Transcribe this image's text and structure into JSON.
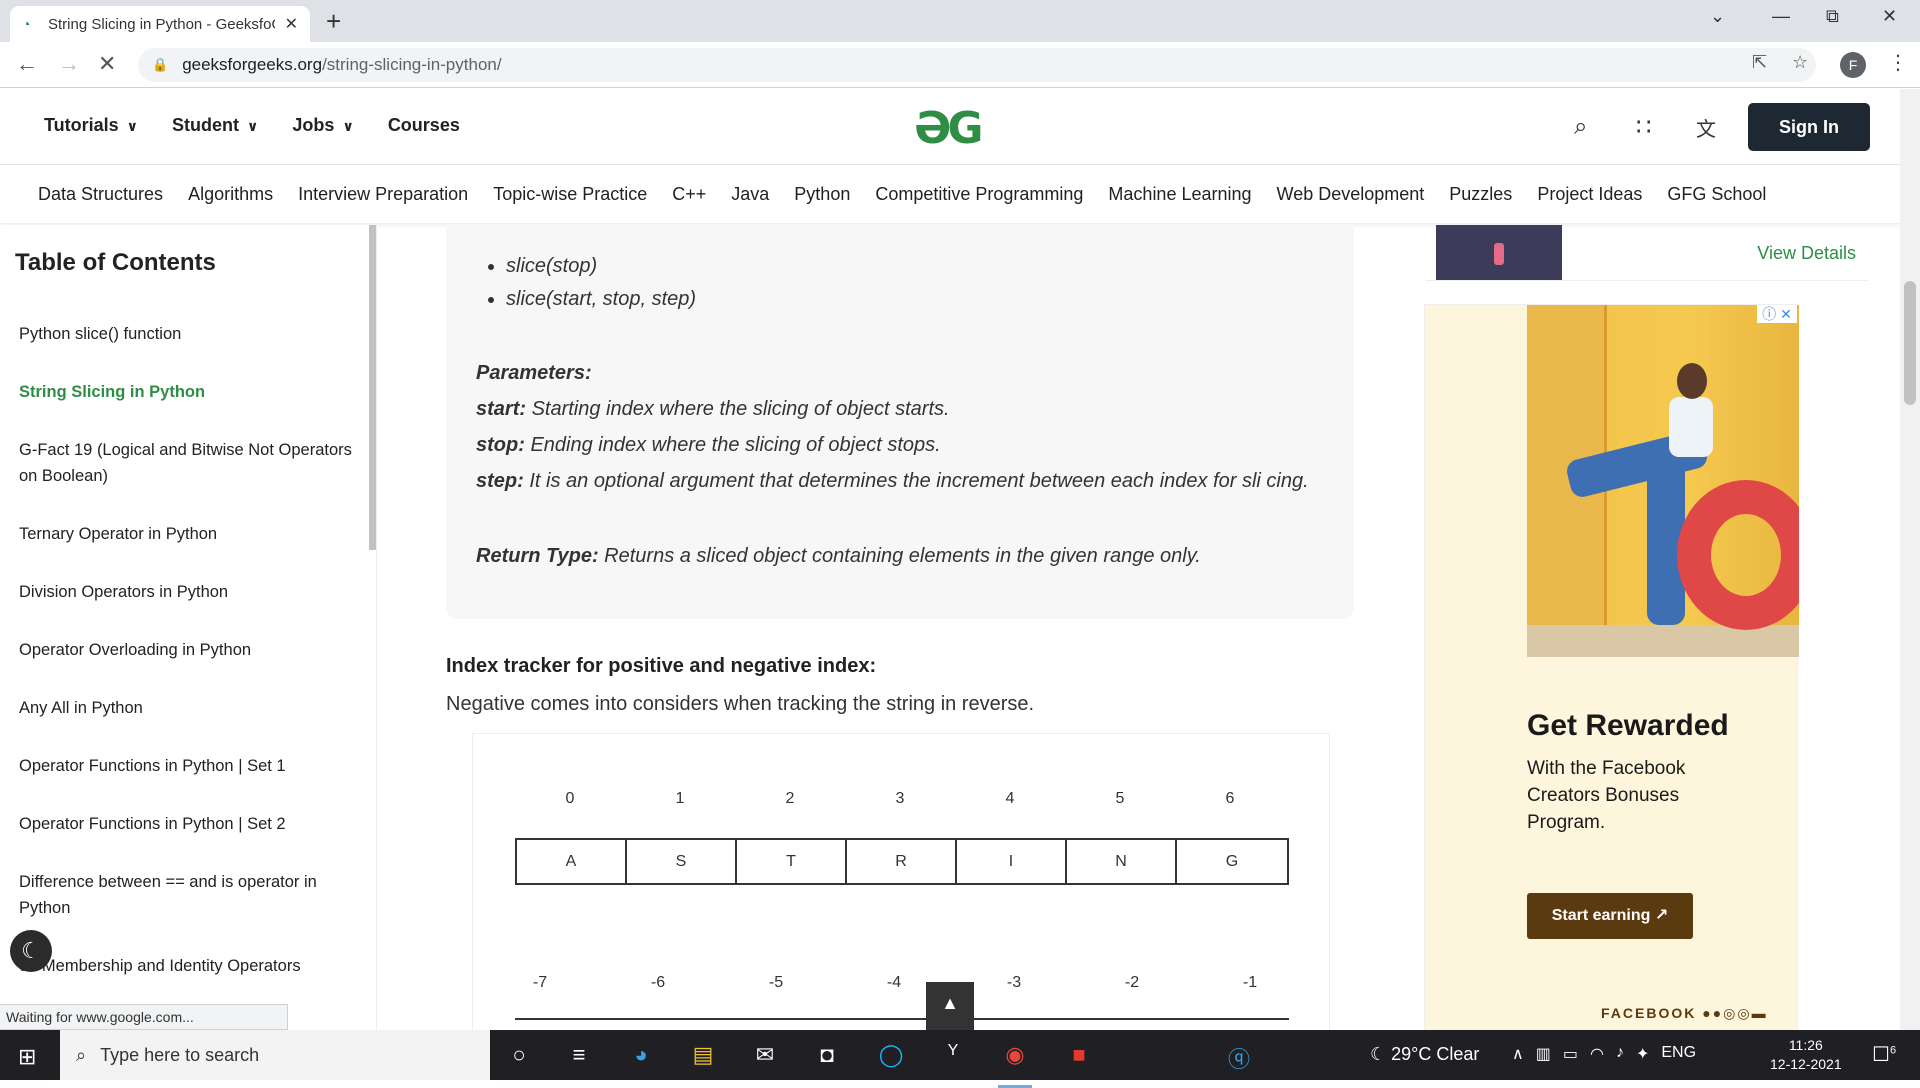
{
  "browser": {
    "tab_title": "String Slicing in Python - GeeksfoGeeks",
    "tab_favicon": "gfg-favicon-icon",
    "url_host": "geeksforgeeks.org",
    "url_path": "/string-slicing-in-python/",
    "profile_initial": "F",
    "status_text": "Waiting for www.google.com..."
  },
  "site": {
    "logo_text": "ƏG",
    "top_nav": [
      {
        "label": "Tutorials",
        "dropdown": true
      },
      {
        "label": "Student",
        "dropdown": true
      },
      {
        "label": "Jobs",
        "dropdown": true
      },
      {
        "label": "Courses",
        "dropdown": false
      }
    ],
    "signin_label": "Sign In",
    "sub_nav": [
      "Data Structures",
      "Algorithms",
      "Interview Preparation",
      "Topic-wise Practice",
      "C++",
      "Java",
      "Python",
      "Competitive Programming",
      "Machine Learning",
      "Web Development",
      "Puzzles",
      "Project Ideas",
      "GFG School"
    ]
  },
  "toc": {
    "title": "Table of Contents",
    "items": [
      {
        "label": "Python slice() function",
        "active": false
      },
      {
        "label": "String Slicing in Python",
        "active": true
      },
      {
        "label": "G-Fact 19 (Logical and Bitwise Not Operators on Boolean)",
        "active": false
      },
      {
        "label": "Ternary Operator in Python",
        "active": false
      },
      {
        "label": "Division Operators in Python",
        "active": false
      },
      {
        "label": "Operator Overloading in Python",
        "active": false
      },
      {
        "label": "Any All in Python",
        "active": false
      },
      {
        "label": "Operator Functions in Python | Set 1",
        "active": false
      },
      {
        "label": "Operator Functions in Python | Set 2",
        "active": false
      },
      {
        "label": "Difference between == and is operator in Python",
        "active": false
      },
      {
        "label": "on Membership and Identity Operators",
        "active": false
      }
    ]
  },
  "article": {
    "syntax_items": [
      "slice(stop)",
      "slice(start, stop, step)"
    ],
    "params_heading": "Parameters:",
    "params": [
      {
        "name": "start:",
        "desc": " Starting index where the slicing of object starts."
      },
      {
        "name": "stop:",
        "desc": " Ending index where the slicing of object stops."
      },
      {
        "name": "step:",
        "desc": " It is an optional argument that determines the increment between each index for sli cing."
      }
    ],
    "return_label": "Return Type:",
    "return_desc": " Returns a sliced object containing elements in the given range only.",
    "index_heading": "Index tracker for positive and negative index:",
    "index_para": "Negative comes into considers when tracking the string in reverse.",
    "figure": {
      "positive_indices": [
        "0",
        "1",
        "2",
        "3",
        "4",
        "5",
        "6"
      ],
      "chars": [
        "A",
        "S",
        "T",
        "R",
        "I",
        "N",
        "G"
      ],
      "negative_indices": [
        "-7",
        "-6",
        "-5",
        "-4",
        "-3",
        "-2",
        "-1"
      ]
    }
  },
  "sidebar": {
    "view_details": "View Details",
    "ad": {
      "title": "Get Rewarded",
      "text": "With the Facebook Creators Bonuses Program.",
      "button": "Start earning ↗",
      "brand": "FACEBOOK"
    }
  },
  "taskbar": {
    "search_placeholder": "Type here to search",
    "weather": "29°C  Clear",
    "lang": "ENG",
    "time": "11:26",
    "date": "12-12-2021",
    "notif_count": "6"
  },
  "colors": {
    "gfg_green": "#2f8d46",
    "signin_bg": "#1e2833",
    "ad_button": "#5c3a0f"
  }
}
